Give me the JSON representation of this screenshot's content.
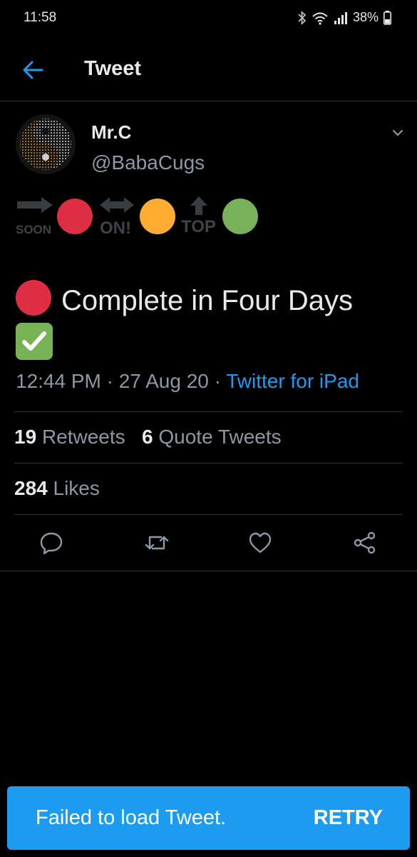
{
  "status_bar": {
    "time": "11:58",
    "battery": "38%",
    "icons": [
      "bluetooth-icon",
      "wifi-icon",
      "signal-icon",
      "battery-icon"
    ]
  },
  "header": {
    "title": "Tweet",
    "back_icon": "back-arrow-icon"
  },
  "tweet": {
    "author": {
      "display_name": "Mr.C",
      "handle": "@BabaCugs"
    },
    "legend": {
      "soon_label": "SOON",
      "on_label": "ON!",
      "top_label": "TOP",
      "colors": {
        "red": "#dd2e44",
        "orange": "#ffac33",
        "green": "#78b159"
      }
    },
    "text": "Complete in Four Days",
    "timestamp": "12:44 PM · 27 Aug 20 · ",
    "source": "Twitter for iPad",
    "stats": {
      "retweets_count": "19",
      "retweets_label": "Retweets",
      "quotes_count": "6",
      "quotes_label": "Quote Tweets",
      "likes_count": "284",
      "likes_label": "Likes"
    }
  },
  "snackbar": {
    "message": "Failed to load Tweet.",
    "action": "RETRY"
  },
  "colors": {
    "accent": "#1d9bf0",
    "background": "#000000",
    "divider": "#2f3336",
    "secondary_text": "#8b98a5"
  }
}
